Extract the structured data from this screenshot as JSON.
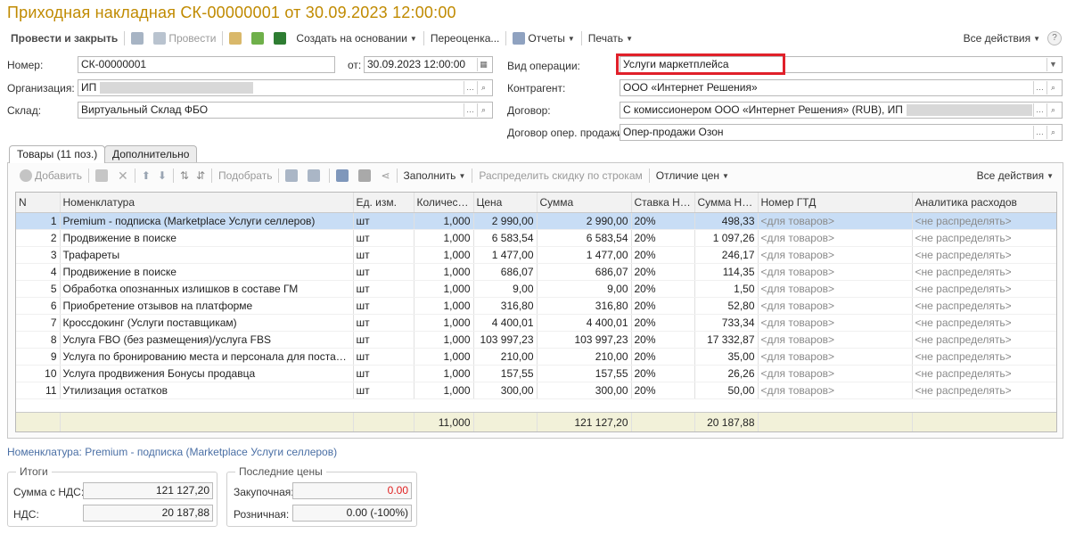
{
  "title": "Приходная накладная СК-00000001 от 30.09.2023 12:00:00",
  "toolbar": {
    "post_close": "Провести и закрыть",
    "post": "Провести",
    "create_based": "Создать на основании",
    "revaluation": "Переоценка...",
    "reports": "Отчеты",
    "print": "Печать",
    "all_actions": "Все действия",
    "help": "?"
  },
  "form": {
    "number_label": "Номер:",
    "number_value": "СК-00000001",
    "date_label": "от:",
    "date_value": "30.09.2023 12:00:00",
    "org_label": "Организация:",
    "org_value": "ИП",
    "warehouse_label": "Склад:",
    "warehouse_value": "Виртуальный Склад ФБО",
    "operation_label": "Вид операции:",
    "operation_value": "Услуги маркетплейса",
    "counterparty_label": "Контрагент:",
    "counterparty_value": "ООО «Интернет Решения»",
    "contract_label": "Договор:",
    "contract_value": "С комиссионером ООО «Интернет Решения» (RUB), ИП",
    "sales_contract_label": "Договор опер. продажи:",
    "sales_contract_value": "Опер-продажи Озон"
  },
  "tabs": [
    {
      "label": "Товары (11 поз.)"
    },
    {
      "label": "Дополнительно"
    }
  ],
  "goods_toolbar": {
    "add": "Добавить",
    "pick": "Подобрать",
    "fill": "Заполнить",
    "distribute": "Распределить скидку по строкам",
    "price_diff": "Отличие цен",
    "all_actions": "Все действия"
  },
  "table": {
    "headers": [
      "N",
      "Номенклатура",
      "Ед. изм.",
      "Количество",
      "Цена",
      "Сумма",
      "Ставка НДС",
      "Сумма НДС",
      "Номер ГТД",
      "Аналитика расходов"
    ],
    "rows": [
      [
        "1",
        "Premium - подписка (Marketplace Услуги селлеров)",
        "шт",
        "1,000",
        "2 990,00",
        "2 990,00",
        "20%",
        "498,33",
        "<для товаров>",
        "<не распределять>"
      ],
      [
        "2",
        "Продвижение в поиске",
        "шт",
        "1,000",
        "6 583,54",
        "6 583,54",
        "20%",
        "1 097,26",
        "<для товаров>",
        "<не распределять>"
      ],
      [
        "3",
        "Трафареты",
        "шт",
        "1,000",
        "1 477,00",
        "1 477,00",
        "20%",
        "246,17",
        "<для товаров>",
        "<не распределять>"
      ],
      [
        "4",
        "Продвижение в поиске",
        "шт",
        "1,000",
        "686,07",
        "686,07",
        "20%",
        "114,35",
        "<для товаров>",
        "<не распределять>"
      ],
      [
        "5",
        "Обработка опознанных излишков в составе ГМ",
        "шт",
        "1,000",
        "9,00",
        "9,00",
        "20%",
        "1,50",
        "<для товаров>",
        "<не распределять>"
      ],
      [
        "6",
        "Приобретение отзывов на платформе",
        "шт",
        "1,000",
        "316,80",
        "316,80",
        "20%",
        "52,80",
        "<для товаров>",
        "<не распределять>"
      ],
      [
        "7",
        "Кроссдокинг (Услуги поставщикам)",
        "шт",
        "1,000",
        "4 400,01",
        "4 400,01",
        "20%",
        "733,34",
        "<для товаров>",
        "<не распределять>"
      ],
      [
        "8",
        "Услуга FBO (без размещения)/услуга FBS",
        "шт",
        "1,000",
        "103 997,23",
        "103 997,23",
        "20%",
        "17 332,87",
        "<для товаров>",
        "<не распределять>"
      ],
      [
        "9",
        "Услуга по бронированию места и персонала для поставки с ...",
        "шт",
        "1,000",
        "210,00",
        "210,00",
        "20%",
        "35,00",
        "<для товаров>",
        "<не распределять>"
      ],
      [
        "10",
        "Услуга продвижения Бонусы продавца",
        "шт",
        "1,000",
        "157,55",
        "157,55",
        "20%",
        "26,26",
        "<для товаров>",
        "<не распределять>"
      ],
      [
        "11",
        "Утилизация остатков",
        "шт",
        "1,000",
        "300,00",
        "300,00",
        "20%",
        "50,00",
        "<для товаров>",
        "<не распределять>"
      ]
    ],
    "totals": {
      "quantity": "11,000",
      "sum": "121 127,20",
      "vat_sum": "20 187,88"
    }
  },
  "nomenclature_link": "Номенклатура: Premium - подписка (Marketplace Услуги селлеров)",
  "totals_group": {
    "title": "Итоги",
    "sum_vat_label": "Сумма с НДС:",
    "sum_vat_value": "121 127,20",
    "vat_label": "НДС:",
    "vat_value": "20 187,88"
  },
  "last_prices": {
    "title": "Последние цены",
    "purchase_label": "Закупочная:",
    "purchase_value": "0.00",
    "retail_label": "Розничная:",
    "retail_value": "0.00 (-100%)"
  },
  "colors": {
    "title": "#c08a00",
    "highlight": "#e0202a",
    "selected_row": "#c8ddf5",
    "link": "#4a6fa5"
  }
}
